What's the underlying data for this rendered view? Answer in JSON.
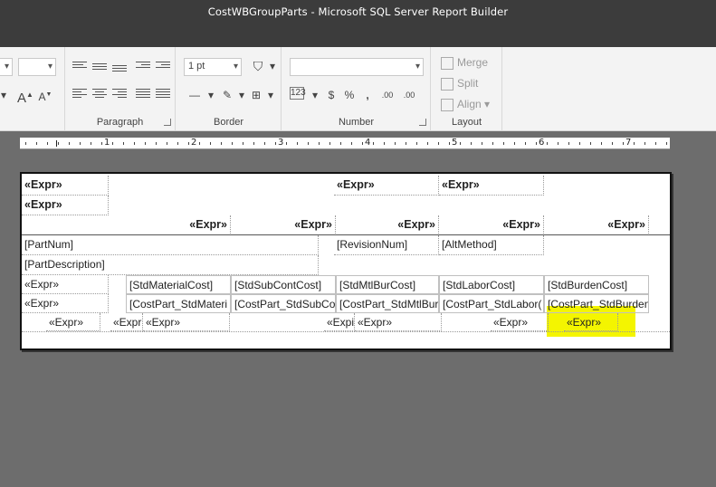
{
  "window": {
    "title": "CostWBGroupParts - Microsoft SQL Server Report Builder"
  },
  "ribbon": {
    "paragraph_label": "Paragraph",
    "border_label": "Border",
    "number_label": "Number",
    "layout_label": "Layout",
    "border_width_value": "1 pt",
    "number_format_glyph": "123",
    "currency_glyph": "$",
    "percent_glyph": "%",
    "comma_glyph": ",",
    "decrease_decimals_glyph": ".00",
    "increase_decimals_glyph": ".00",
    "merge_label": "Merge",
    "split_label": "Split",
    "align_label": "Align",
    "font_grow_glyph": "A",
    "font_shrink_glyph": "A",
    "icons": [
      "align-top-icon",
      "align-middle-icon",
      "align-bottom-icon",
      "decrease-indent-icon",
      "increase-indent-icon",
      "align-left-icon",
      "align-center-icon",
      "align-right-icon",
      "bulleted-list-icon",
      "numbered-list-icon",
      "fill-bucket-icon",
      "pen-color-icon",
      "border-style-icon",
      "borders-icon",
      "merge-icon",
      "split-icon",
      "align-icon"
    ]
  },
  "ruler": {
    "labels": [
      "1",
      "2",
      "3",
      "4",
      "5",
      "6",
      "7"
    ]
  },
  "report": {
    "row1": [
      "«Expr»",
      "«Expr»",
      "«Expr»"
    ],
    "row2": [
      "«Expr»"
    ],
    "row3": [
      "«Expr»",
      "«Expr»",
      "«Expr»",
      "«Expr»",
      "«Expr»"
    ],
    "row4": [
      "[PartNum]",
      "[RevisionNum]",
      "[AltMethod]"
    ],
    "row5": [
      "[PartDescription]"
    ],
    "row6": [
      "«Expr»",
      "[StdMaterialCost]",
      "[StdSubContCost]",
      "[StdMtlBurCost]",
      "[StdLaborCost]",
      "[StdBurdenCost]"
    ],
    "row7": [
      "«Expr»",
      "[CostPart_StdMateri",
      "[CostPart_StdSubCo",
      "[CostPart_StdMtlBur",
      "[CostPart_StdLabor(",
      "[CostPart_StdBurden"
    ],
    "row8": [
      "«Expr»",
      "«Expr",
      "«Expr»",
      "«Expi",
      "«Expr»",
      "«Expr»",
      "«Expr»"
    ]
  },
  "colors": {
    "title_bar": "#3c3c3c",
    "ribbon": "#f3f3f3",
    "canvas": "#6d6d6d",
    "highlight": "#f4f500"
  }
}
